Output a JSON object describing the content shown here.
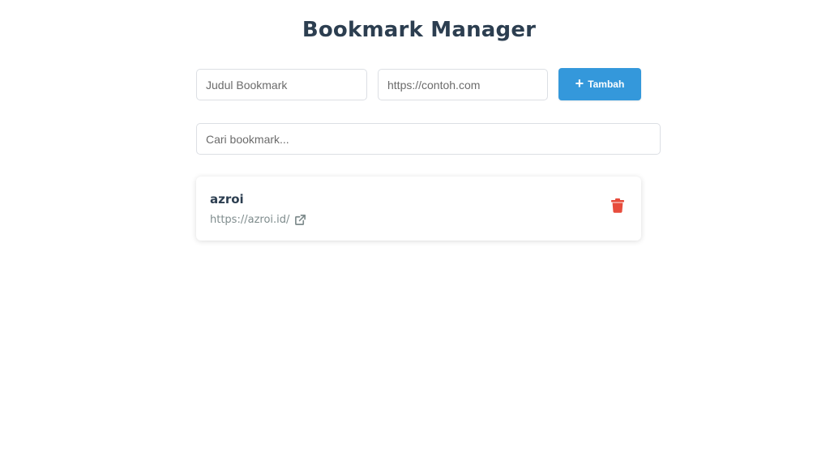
{
  "header": {
    "title": "Bookmark Manager"
  },
  "form": {
    "title_placeholder": "Judul Bookmark",
    "title_value": "",
    "url_placeholder": "https://contoh.com",
    "url_value": "",
    "add_icon": "plus-icon",
    "add_label": "Tambah"
  },
  "search": {
    "placeholder": "Cari bookmark...",
    "value": ""
  },
  "bookmarks": [
    {
      "title": "azroi",
      "url": "https://azroi.id/",
      "link_icon": "external-link-icon",
      "delete_icon": "trash-icon"
    }
  ],
  "colors": {
    "primary": "#3498db",
    "text": "#2c3e50",
    "muted": "#7f8c8d",
    "danger": "#e74c3c"
  }
}
